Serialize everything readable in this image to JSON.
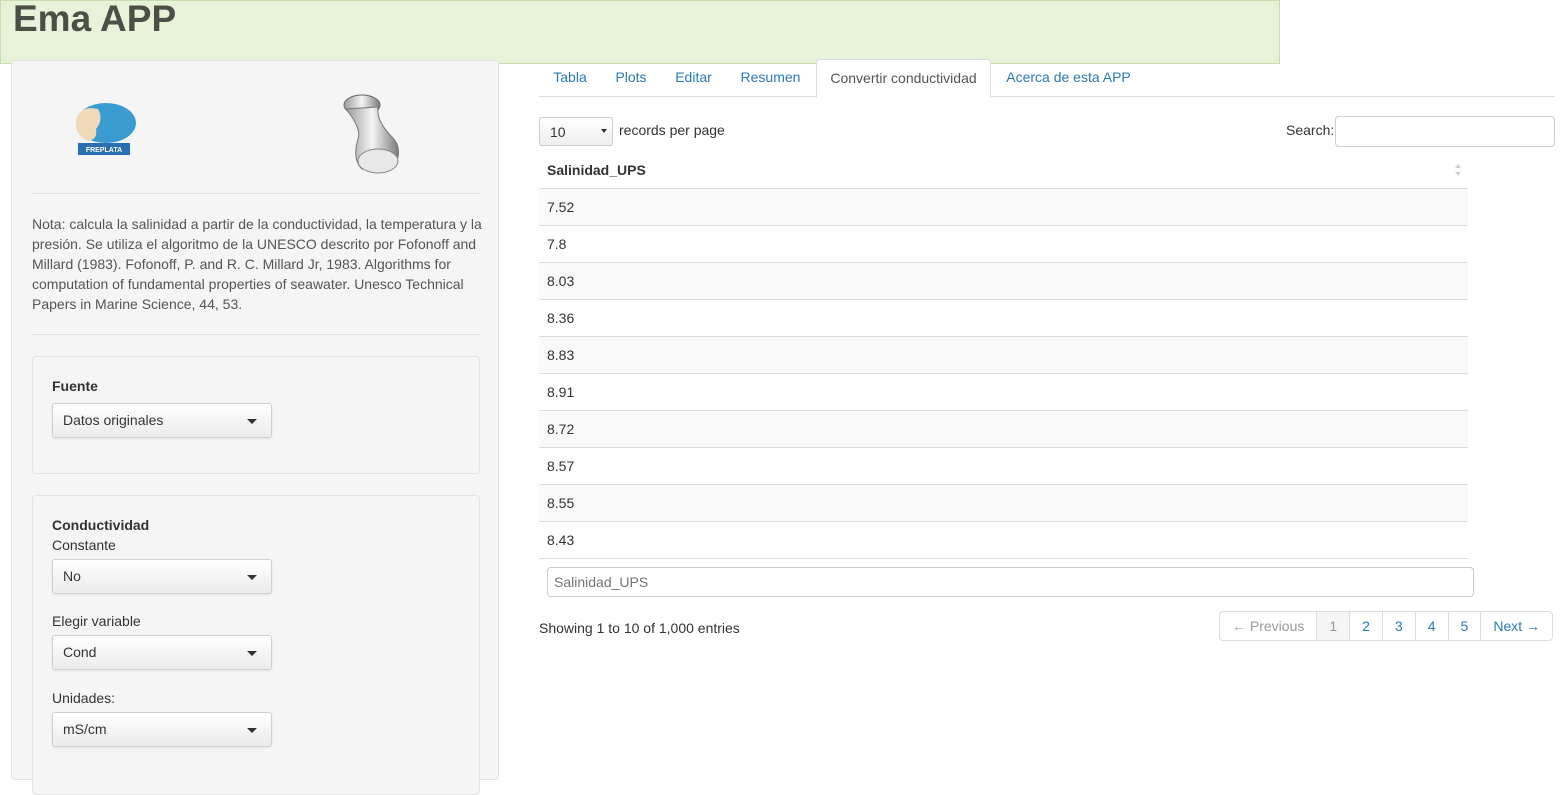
{
  "app": {
    "title": "Ema APP"
  },
  "sidebar": {
    "logos": {
      "freplata_text": "FREPLATA"
    },
    "note": "Nota: calcula la salinidad a partir de la conductividad, la temperatura y la presión. Se utiliza el algoritmo de la UNESCO descrito por Fofonoff and Millard (1983). Fofonoff, P. and R. C. Millard Jr, 1983. Algorithms for computation of fundamental properties of seawater. Unesco Technical Papers in Marine Science, 44, 53.",
    "fuente": {
      "label": "Fuente",
      "value": "Datos originales"
    },
    "conductividad": {
      "label": "Conductividad",
      "constante_label": "Constante",
      "constante_value": "No",
      "variable_label": "Elegir variable",
      "variable_value": "Cond",
      "unidades_label": "Unidades:",
      "unidades_value": "mS/cm"
    }
  },
  "tabs": [
    {
      "label": "Tabla"
    },
    {
      "label": "Plots"
    },
    {
      "label": "Editar"
    },
    {
      "label": "Resumen"
    },
    {
      "label": "Convertir conductividad",
      "active": true
    },
    {
      "label": "Acerca de esta APP"
    }
  ],
  "table_controls": {
    "page_length": "10",
    "page_length_label": "records per page",
    "search_label": "Search:",
    "search_value": ""
  },
  "table": {
    "column": "Salinidad_UPS",
    "rows": [
      "7.52",
      "7.8",
      "8.03",
      "8.36",
      "8.83",
      "8.91",
      "8.72",
      "8.57",
      "8.55",
      "8.43"
    ],
    "filter_placeholder": "Salinidad_UPS"
  },
  "footer": {
    "info": "Showing 1 to 10 of 1,000 entries",
    "pagination": {
      "previous": "← Previous",
      "pages": [
        "1",
        "2",
        "3",
        "4",
        "5"
      ],
      "next": "Next →"
    }
  },
  "colors": {
    "title_bar_bg": "#e7f2d8",
    "link": "#2a7ab5",
    "sidebar_bg": "#f5f5f5"
  }
}
